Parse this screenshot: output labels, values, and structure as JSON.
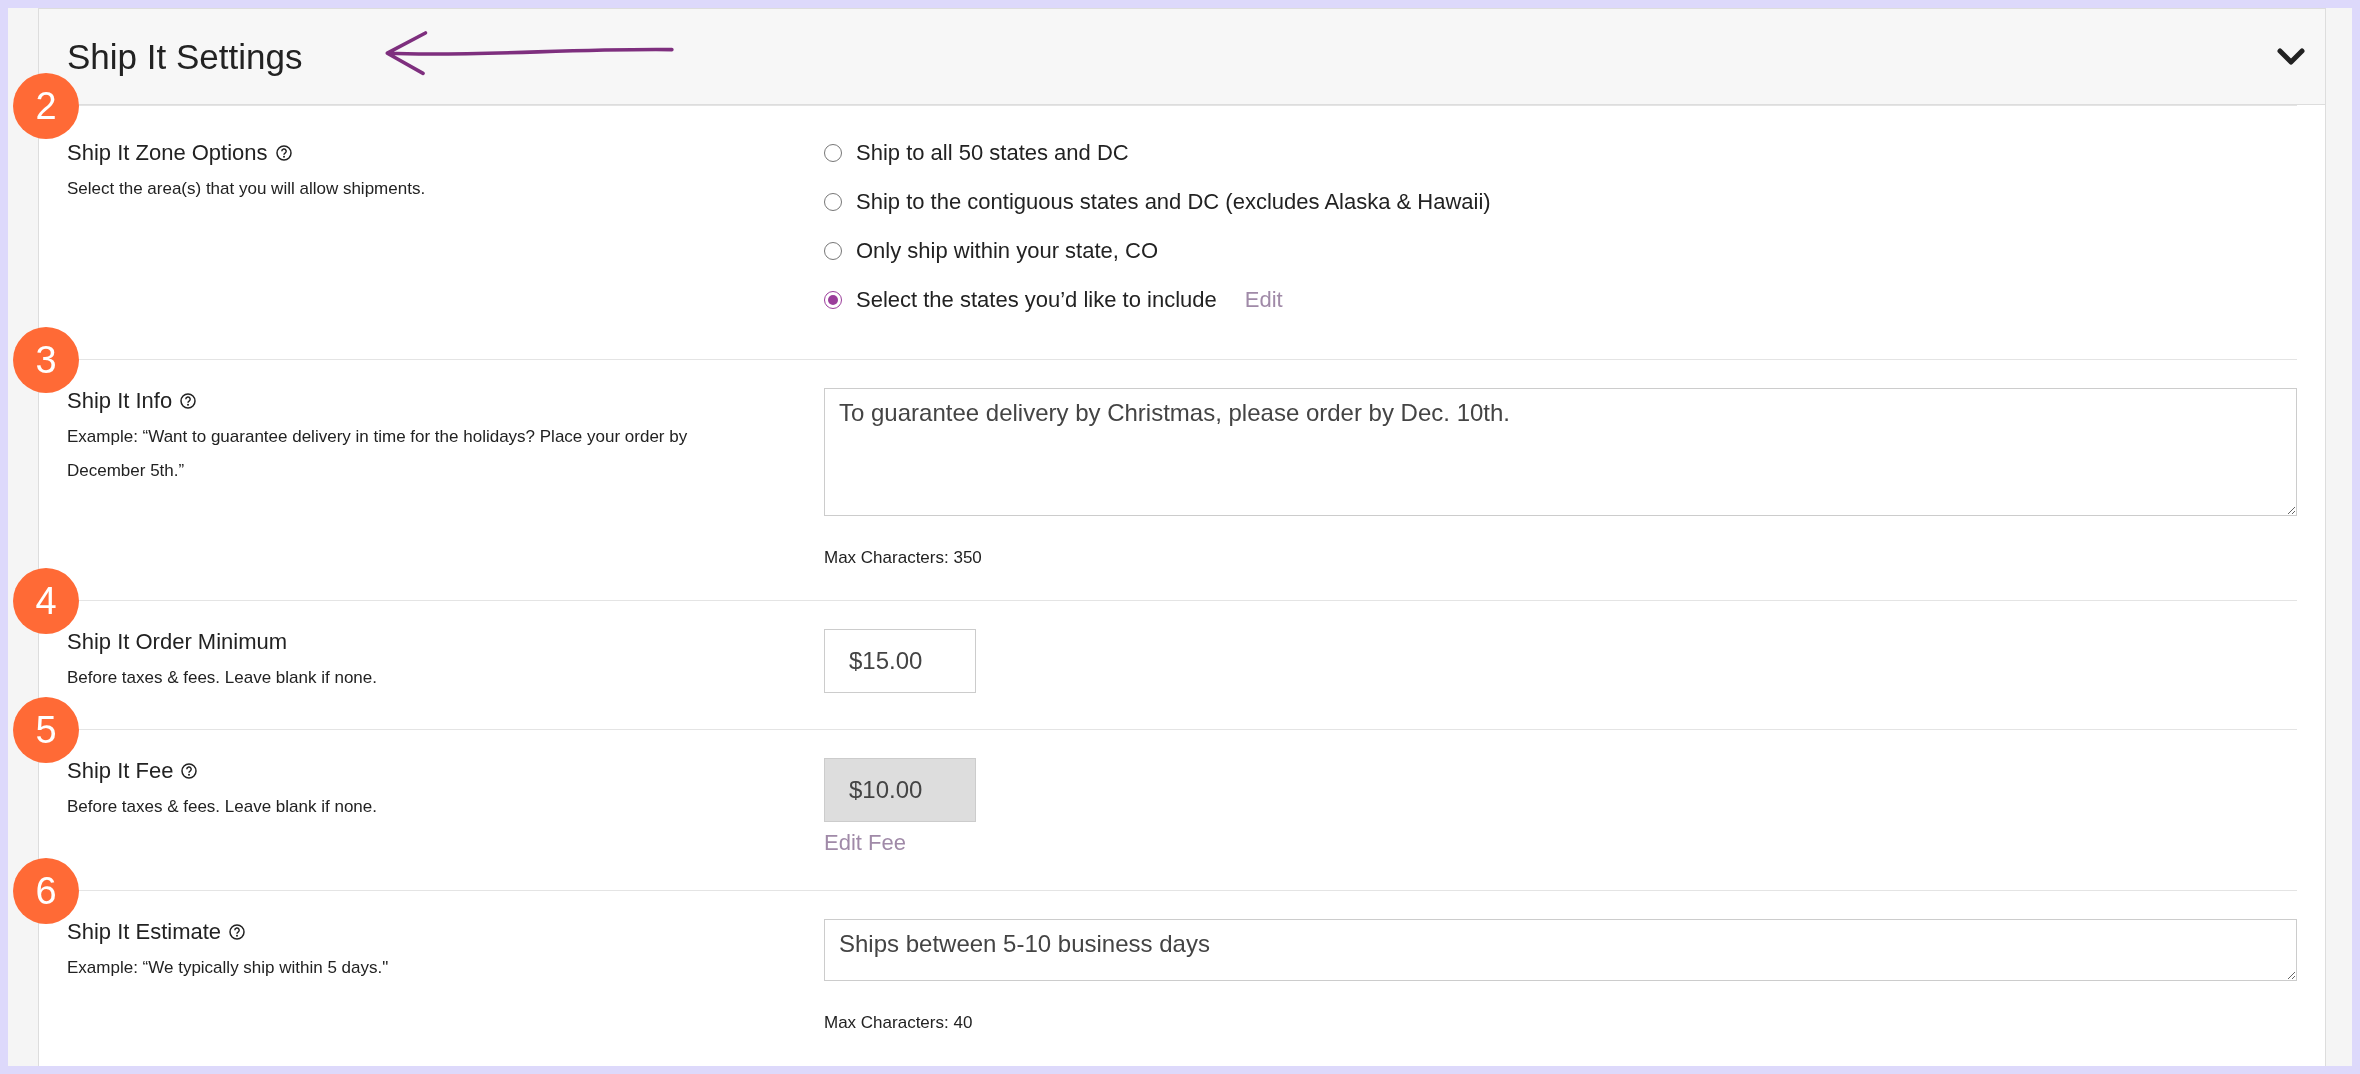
{
  "header": {
    "title": "Ship It Settings",
    "expanded": true
  },
  "sections": [
    {
      "kind": "radio",
      "badge": "2",
      "label": "Ship It Zone Options",
      "help": true,
      "description": "Select the area(s) that you will allow shipments.",
      "options": [
        {
          "label": "Ship to all 50 states and DC",
          "selected": false
        },
        {
          "label": "Ship to the contiguous states and DC (excludes Alaska & Hawaii)",
          "selected": false
        },
        {
          "label": "Only ship within your state, CO",
          "selected": false
        },
        {
          "label": "Select the states you’d like to include",
          "selected": true,
          "link": "Edit"
        }
      ]
    },
    {
      "kind": "textarea",
      "badge": "3",
      "label": "Ship It Info",
      "help": true,
      "description": "Example: “Want to guarantee delivery in time for the holidays? Place your order by December 5th.”",
      "value": "To guarantee delivery by Christmas, please order by Dec. 10th.",
      "tall": true,
      "note": "Max Characters: 350"
    },
    {
      "kind": "input",
      "badge": "4",
      "label": "Ship It Order Minimum",
      "help": false,
      "description": "Before taxes & fees. Leave blank if none.",
      "value": "$15.00",
      "disabled": false
    },
    {
      "kind": "input",
      "badge": "5",
      "label": "Ship It Fee",
      "help": true,
      "description": "Before taxes & fees. Leave blank if none.",
      "value": "$10.00",
      "disabled": true,
      "link": "Edit Fee"
    },
    {
      "kind": "textarea",
      "badge": "6",
      "label": "Ship It Estimate",
      "help": true,
      "description": "Example: “We typically ship within 5 days.\"",
      "value": "Ships between 5-10 business days",
      "tall": false,
      "note": "Max Characters: 40"
    }
  ]
}
